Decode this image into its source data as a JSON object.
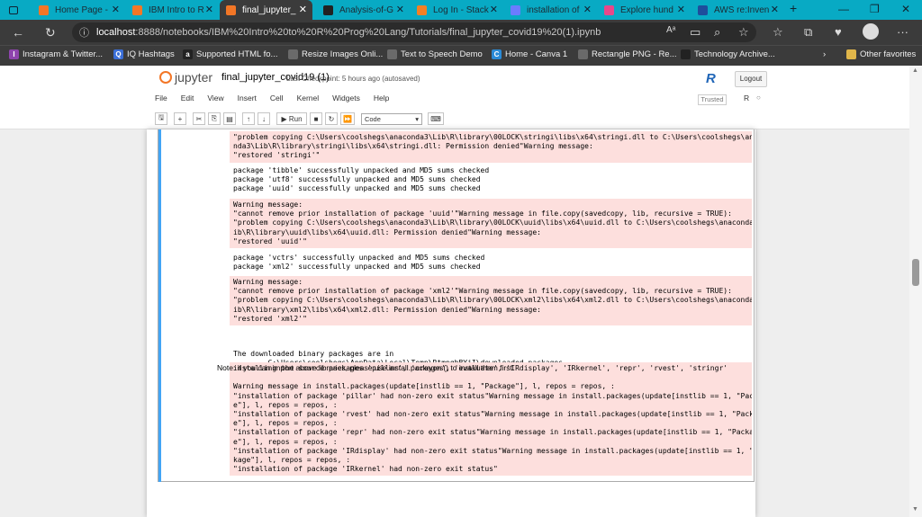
{
  "browser": {
    "tabs": [
      {
        "title": "Home Page -",
        "color": "#f37626",
        "active": false
      },
      {
        "title": "IBM Intro to R",
        "color": "#f37626",
        "active": false
      },
      {
        "title": "final_jupyter_",
        "color": "#f37626",
        "active": true
      },
      {
        "title": "Analysis-of-G",
        "color": "#222222",
        "active": false
      },
      {
        "title": "Log In - Stack",
        "color": "#f48024",
        "active": false
      },
      {
        "title": "installation of",
        "color": "#6b7cff",
        "active": false
      },
      {
        "title": "Explore hund",
        "color": "#e8488a",
        "active": false
      },
      {
        "title": "AWS re:Inven",
        "color": "#1e4e9c",
        "active": false
      }
    ],
    "url_host": "localhost",
    "url_path": ":8888/notebooks/IBM%20Intro%20to%20R%20Prog%20Lang/Tutorials/final_jupyter_covid19%20(1).ipynb",
    "favorites": [
      {
        "label": "Instagram & Twitter...",
        "icon": "I",
        "color": "#8e44ad"
      },
      {
        "label": "IQ Hashtags",
        "icon": "Q",
        "color": "#3b6fd8"
      },
      {
        "label": "Supported HTML fo...",
        "icon": "a",
        "color": "#222222"
      },
      {
        "label": "Resize Images Onli...",
        "icon": "",
        "color": "#6a6a6a"
      },
      {
        "label": "Text to Speech Demo",
        "icon": "",
        "color": "#6a6a6a"
      },
      {
        "label": "Home - Canva 1",
        "icon": "C",
        "color": "#2a8bd8"
      },
      {
        "label": "Rectangle PNG - Re...",
        "icon": "",
        "color": "#6a6a6a"
      },
      {
        "label": "Technology Archive...",
        "icon": "",
        "color": "#222222"
      }
    ],
    "other_favorites": "Other favorites"
  },
  "notebook": {
    "logo_text": "jupyter",
    "title": "final_jupyter_covid19 (1)",
    "checkpoint": "Last Checkpoint: 5 hours ago  (autosaved)",
    "logout": "Logout",
    "menu": [
      "File",
      "Edit",
      "View",
      "Insert",
      "Cell",
      "Kernel",
      "Widgets",
      "Help"
    ],
    "trusted": "Trusted",
    "kernel_name": "R",
    "run_label": "Run",
    "cell_type": "Code"
  },
  "output": {
    "blocks": [
      {
        "kind": "stderr",
        "text": "\"problem copying C:\\Users\\coolshegs\\anaconda3\\Lib\\R\\library\\00LOCK\\stringi\\libs\\x64\\stringi.dll to C:\\Users\\coolshegs\\anaco\nnda3\\Lib\\R\\library\\stringi\\libs\\x64\\stringi.dll: Permission denied\"Warning message:\n\"restored 'stringi'\""
      },
      {
        "kind": "stdout",
        "text": "package 'tibble' successfully unpacked and MD5 sums checked\npackage 'utf8' successfully unpacked and MD5 sums checked\npackage 'uuid' successfully unpacked and MD5 sums checked"
      },
      {
        "kind": "stderr",
        "text": "Warning message:\n\"cannot remove prior installation of package 'uuid'\"Warning message in file.copy(savedcopy, lib, recursive = TRUE):\n\"problem copying C:\\Users\\coolshegs\\anaconda3\\Lib\\R\\library\\00LOCK\\uuid\\libs\\x64\\uuid.dll to C:\\Users\\coolshegs\\anaconda3\\L\nib\\R\\library\\uuid\\libs\\x64\\uuid.dll: Permission denied\"Warning message:\n\"restored 'uuid'\""
      },
      {
        "kind": "stdout",
        "text": "package 'vctrs' successfully unpacked and MD5 sums checked\npackage 'xml2' successfully unpacked and MD5 sums checked"
      },
      {
        "kind": "stderr",
        "text": "Warning message:\n\"cannot remove prior installation of package 'xml2'\"Warning message in file.copy(savedcopy, lib, recursive = TRUE):\n\"problem copying C:\\Users\\coolshegs\\anaconda3\\Lib\\R\\library\\00LOCK\\xml2\\libs\\x64\\xml2.dll to C:\\Users\\coolshegs\\anaconda3\\L\nib\\R\\library\\xml2\\libs\\x64\\xml2.dll: Permission denied\"Warning message:\n\"restored 'xml2'\""
      },
      {
        "kind": "stdout",
        "text": "\nThe downloaded binary packages are in\n        C:\\Users\\coolshegs\\AppData\\Local\\Temp\\RtmpgbBYjI\\downloaded_packages"
      },
      {
        "kind": "stderr",
        "text": "installing the source packages 'pillar', 'crayon', 'evaluate', 'IRdisplay', 'IRkernel', 'repr', 'rvest', 'stringr'\n\nWarning message in install.packages(update[instlib == 1, \"Package\"], l, repos = repos, :\n\"installation of package 'pillar' had non-zero exit status\"Warning message in install.packages(update[instlib == 1, \"Packag\ne\"], l, repos = repos, :\n\"installation of package 'rvest' had non-zero exit status\"Warning message in install.packages(update[instlib == 1, \"Packag\ne\"], l, repos = repos, :\n\"installation of package 'repr' had non-zero exit status\"Warning message in install.packages(update[instlib == 1, \"Packag\ne\"], l, repos = repos, :\n\"installation of package 'IRdisplay' had non-zero exit status\"Warning message in install.packages(update[instlib == 1, \"Pac\nkage\"], l, repos = repos, :\n\"installation of package 'IRkernel' had non-zero exit status\""
      }
    ],
    "note": "Note: if you can import above libraries, please use install.packages() to install them first."
  }
}
